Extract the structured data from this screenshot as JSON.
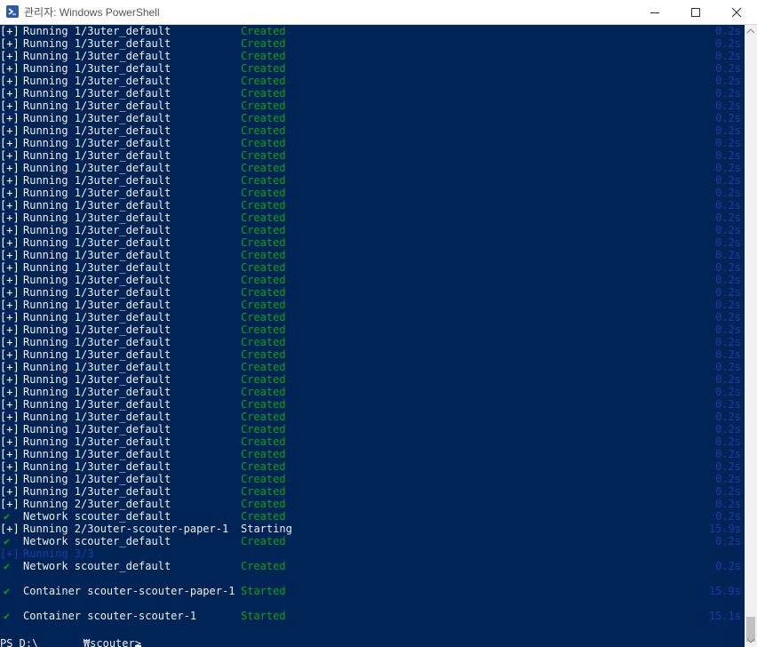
{
  "window": {
    "title": "관리자: Windows PowerShell",
    "icon": "powershell-icon",
    "buttons": [
      "minimize-icon",
      "maximize-icon",
      "close-icon"
    ]
  },
  "colors": {
    "background": "#012456",
    "text": "#eeedf0",
    "green": "#13a10e",
    "dim_blue": "#1a3ea8"
  },
  "console": {
    "lines": [
      {
        "prefix": "[+]",
        "text": "Running 1/3uter_default",
        "status": "Created",
        "time": "0.2s"
      },
      {
        "prefix": "[+]",
        "text": "Running 1/3uter_default",
        "status": "Created",
        "time": "0.2s"
      },
      {
        "prefix": "[+]",
        "text": "Running 1/3uter_default",
        "status": "Created",
        "time": "0.2s"
      },
      {
        "prefix": "[+]",
        "text": "Running 1/3uter_default",
        "status": "Created",
        "time": "0.2s"
      },
      {
        "prefix": "[+]",
        "text": "Running 1/3uter_default",
        "status": "Created",
        "time": "0.2s"
      },
      {
        "prefix": "[+]",
        "text": "Running 1/3uter_default",
        "status": "Created",
        "time": "0.2s"
      },
      {
        "prefix": "[+]",
        "text": "Running 1/3uter_default",
        "status": "Created",
        "time": "0.2s"
      },
      {
        "prefix": "[+]",
        "text": "Running 1/3uter_default",
        "status": "Created",
        "time": "0.2s"
      },
      {
        "prefix": "[+]",
        "text": "Running 1/3uter_default",
        "status": "Created",
        "time": "0.2s"
      },
      {
        "prefix": "[+]",
        "text": "Running 1/3uter_default",
        "status": "Created",
        "time": "0.2s"
      },
      {
        "prefix": "[+]",
        "text": "Running 1/3uter_default",
        "status": "Created",
        "time": "0.2s"
      },
      {
        "prefix": "[+]",
        "text": "Running 1/3uter_default",
        "status": "Created",
        "time": "0.2s"
      },
      {
        "prefix": "[+]",
        "text": "Running 1/3uter_default",
        "status": "Created",
        "time": "0.2s"
      },
      {
        "prefix": "[+]",
        "text": "Running 1/3uter_default",
        "status": "Created",
        "time": "0.2s"
      },
      {
        "prefix": "[+]",
        "text": "Running 1/3uter_default",
        "status": "Created",
        "time": "0.2s"
      },
      {
        "prefix": "[+]",
        "text": "Running 1/3uter_default",
        "status": "Created",
        "time": "0.2s"
      },
      {
        "prefix": "[+]",
        "text": "Running 1/3uter_default",
        "status": "Created",
        "time": "0.2s"
      },
      {
        "prefix": "[+]",
        "text": "Running 1/3uter_default",
        "status": "Created",
        "time": "0.2s"
      },
      {
        "prefix": "[+]",
        "text": "Running 1/3uter_default",
        "status": "Created",
        "time": "0.2s"
      },
      {
        "prefix": "[+]",
        "text": "Running 1/3uter_default",
        "status": "Created",
        "time": "0.2s"
      },
      {
        "prefix": "[+]",
        "text": "Running 1/3uter_default",
        "status": "Created",
        "time": "0.2s"
      },
      {
        "prefix": "[+]",
        "text": "Running 1/3uter_default",
        "status": "Created",
        "time": "0.2s"
      },
      {
        "prefix": "[+]",
        "text": "Running 1/3uter_default",
        "status": "Created",
        "time": "0.2s"
      },
      {
        "prefix": "[+]",
        "text": "Running 1/3uter_default",
        "status": "Created",
        "time": "0.2s"
      },
      {
        "prefix": "[+]",
        "text": "Running 1/3uter_default",
        "status": "Created",
        "time": "0.2s"
      },
      {
        "prefix": "[+]",
        "text": "Running 1/3uter_default",
        "status": "Created",
        "time": "0.2s"
      },
      {
        "prefix": "[+]",
        "text": "Running 1/3uter_default",
        "status": "Created",
        "time": "0.2s"
      },
      {
        "prefix": "[+]",
        "text": "Running 1/3uter_default",
        "status": "Created",
        "time": "0.2s"
      },
      {
        "prefix": "[+]",
        "text": "Running 1/3uter_default",
        "status": "Created",
        "time": "0.2s"
      },
      {
        "prefix": "[+]",
        "text": "Running 1/3uter_default",
        "status": "Created",
        "time": "0.2s"
      },
      {
        "prefix": "[+]",
        "text": "Running 1/3uter_default",
        "status": "Created",
        "time": "0.2s"
      },
      {
        "prefix": "[+]",
        "text": "Running 1/3uter_default",
        "status": "Created",
        "time": "0.2s"
      },
      {
        "prefix": "[+]",
        "text": "Running 1/3uter_default",
        "status": "Created",
        "time": "0.2s"
      },
      {
        "prefix": "[+]",
        "text": "Running 1/3uter_default",
        "status": "Created",
        "time": "0.2s"
      },
      {
        "prefix": "[+]",
        "text": "Running 1/3uter_default",
        "status": "Created",
        "time": "0.2s"
      },
      {
        "prefix": "[+]",
        "text": "Running 1/3uter_default",
        "status": "Created",
        "time": "0.2s"
      },
      {
        "prefix": "[+]",
        "text": "Running 1/3uter_default",
        "status": "Created",
        "time": "0.2s"
      },
      {
        "prefix": "[+]",
        "text": "Running 1/3uter_default",
        "status": "Created",
        "time": "0.2s"
      },
      {
        "prefix": "[+]",
        "text": "Running 2/3uter_default",
        "status": "Created",
        "time": "0.2s"
      },
      {
        "prefix": "✔",
        "text": "Network scouter_default",
        "status": "Created",
        "time": "0.2s"
      },
      {
        "prefix": "[+]",
        "text": "Running 2/3outer-scouter-paper-1",
        "status": "Starting",
        "time": "15.9s"
      },
      {
        "prefix": "✔",
        "text": "Network scouter_default",
        "status": "Created",
        "time": "0.2s"
      },
      {
        "prefix": "[+]",
        "text": "Running 3/3",
        "status": "",
        "time": ""
      },
      {
        "prefix": "✔",
        "text": "Network scouter_default",
        "status": "Created",
        "time": "0.2s"
      },
      {
        "prefix": "",
        "text": "",
        "status": "",
        "time": ""
      },
      {
        "prefix": "✔",
        "text": "Container scouter-scouter-paper-1",
        "status": "Started",
        "time": "15.9s"
      },
      {
        "prefix": "",
        "text": "",
        "status": "",
        "time": ""
      },
      {
        "prefix": "✔",
        "text": "Container scouter-scouter-1",
        "status": "Started",
        "time": "15.1s"
      },
      {
        "prefix": "",
        "text": "",
        "status": "",
        "time": ""
      }
    ],
    "prompt": "PS D:\\       ₩scouter>"
  }
}
